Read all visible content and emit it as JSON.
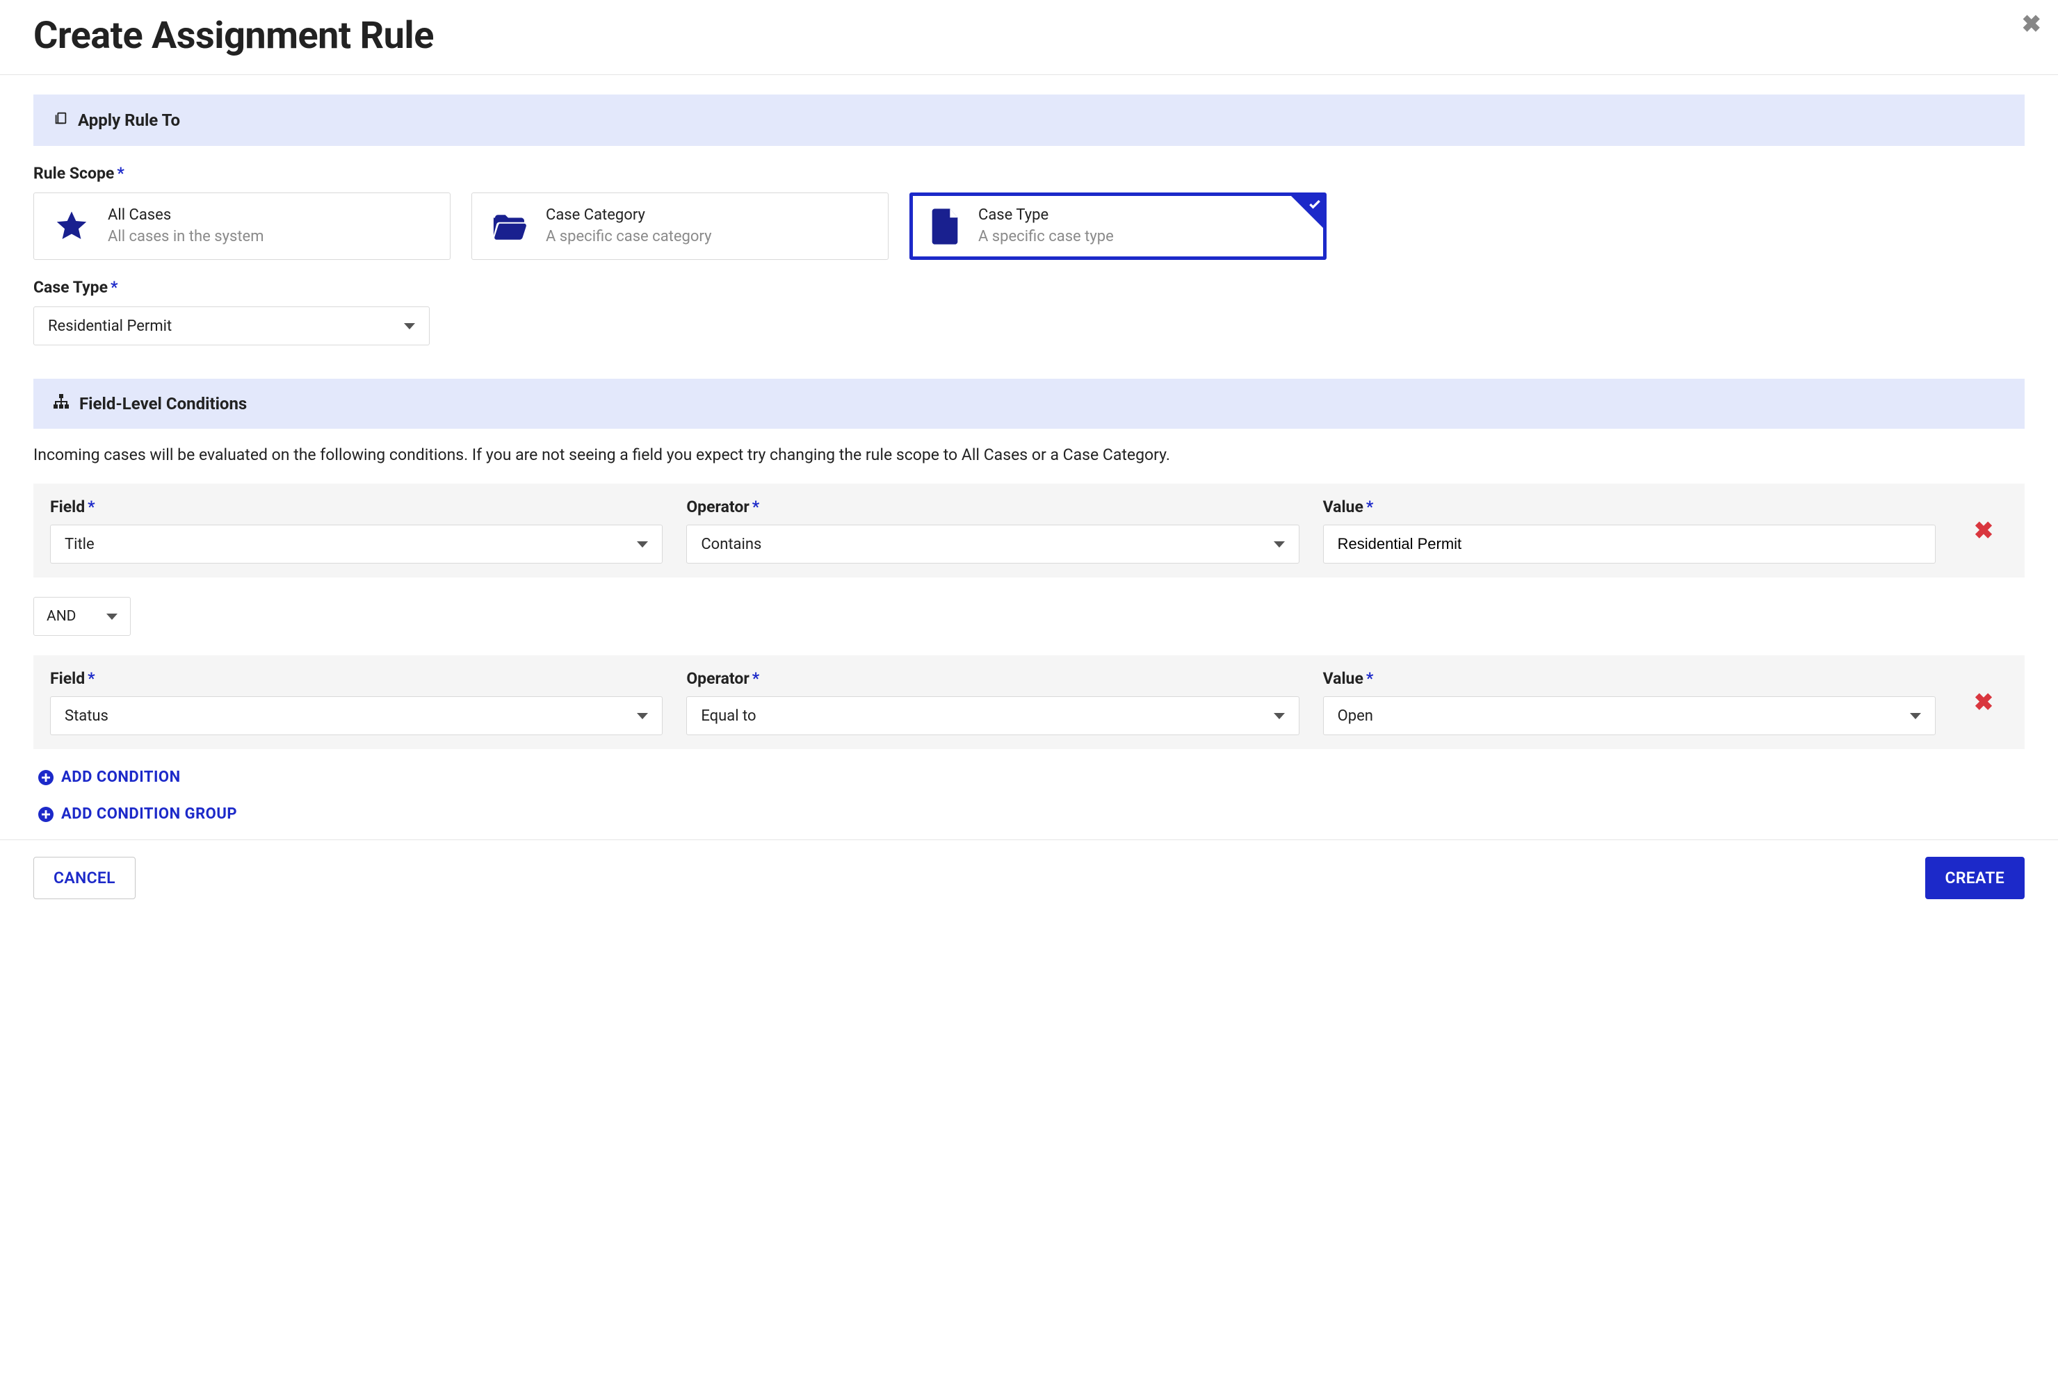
{
  "modal": {
    "title": "Create Assignment Rule",
    "close_icon": "close-icon"
  },
  "apply_section": {
    "heading": "Apply Rule To",
    "rule_scope_label": "Rule Scope",
    "scope_options": [
      {
        "id": "all-cases",
        "title": "All Cases",
        "subtitle": "All cases in the system"
      },
      {
        "id": "case-category",
        "title": "Case Category",
        "subtitle": "A specific case category"
      },
      {
        "id": "case-type",
        "title": "Case Type",
        "subtitle": "A specific case type"
      }
    ],
    "selected_scope": "case-type",
    "case_type_label": "Case Type",
    "case_type_value": "Residential Permit"
  },
  "conditions_section": {
    "heading": "Field-Level Conditions",
    "description": "Incoming cases will be evaluated on the following conditions. If you are not seeing a field you expect try changing the rule scope to All Cases or a Case Category.",
    "col_labels": {
      "field": "Field",
      "operator": "Operator",
      "value": "Value"
    },
    "rows": [
      {
        "field": "Title",
        "operator": "Contains",
        "value": "Residential Permit",
        "value_kind": "text"
      },
      {
        "field": "Status",
        "operator": "Equal to",
        "value": "Open",
        "value_kind": "select"
      }
    ],
    "logic_connector": "AND",
    "add_condition_label": "ADD CONDITION",
    "add_group_label": "ADD CONDITION GROUP"
  },
  "footer": {
    "cancel": "CANCEL",
    "create": "CREATE"
  }
}
